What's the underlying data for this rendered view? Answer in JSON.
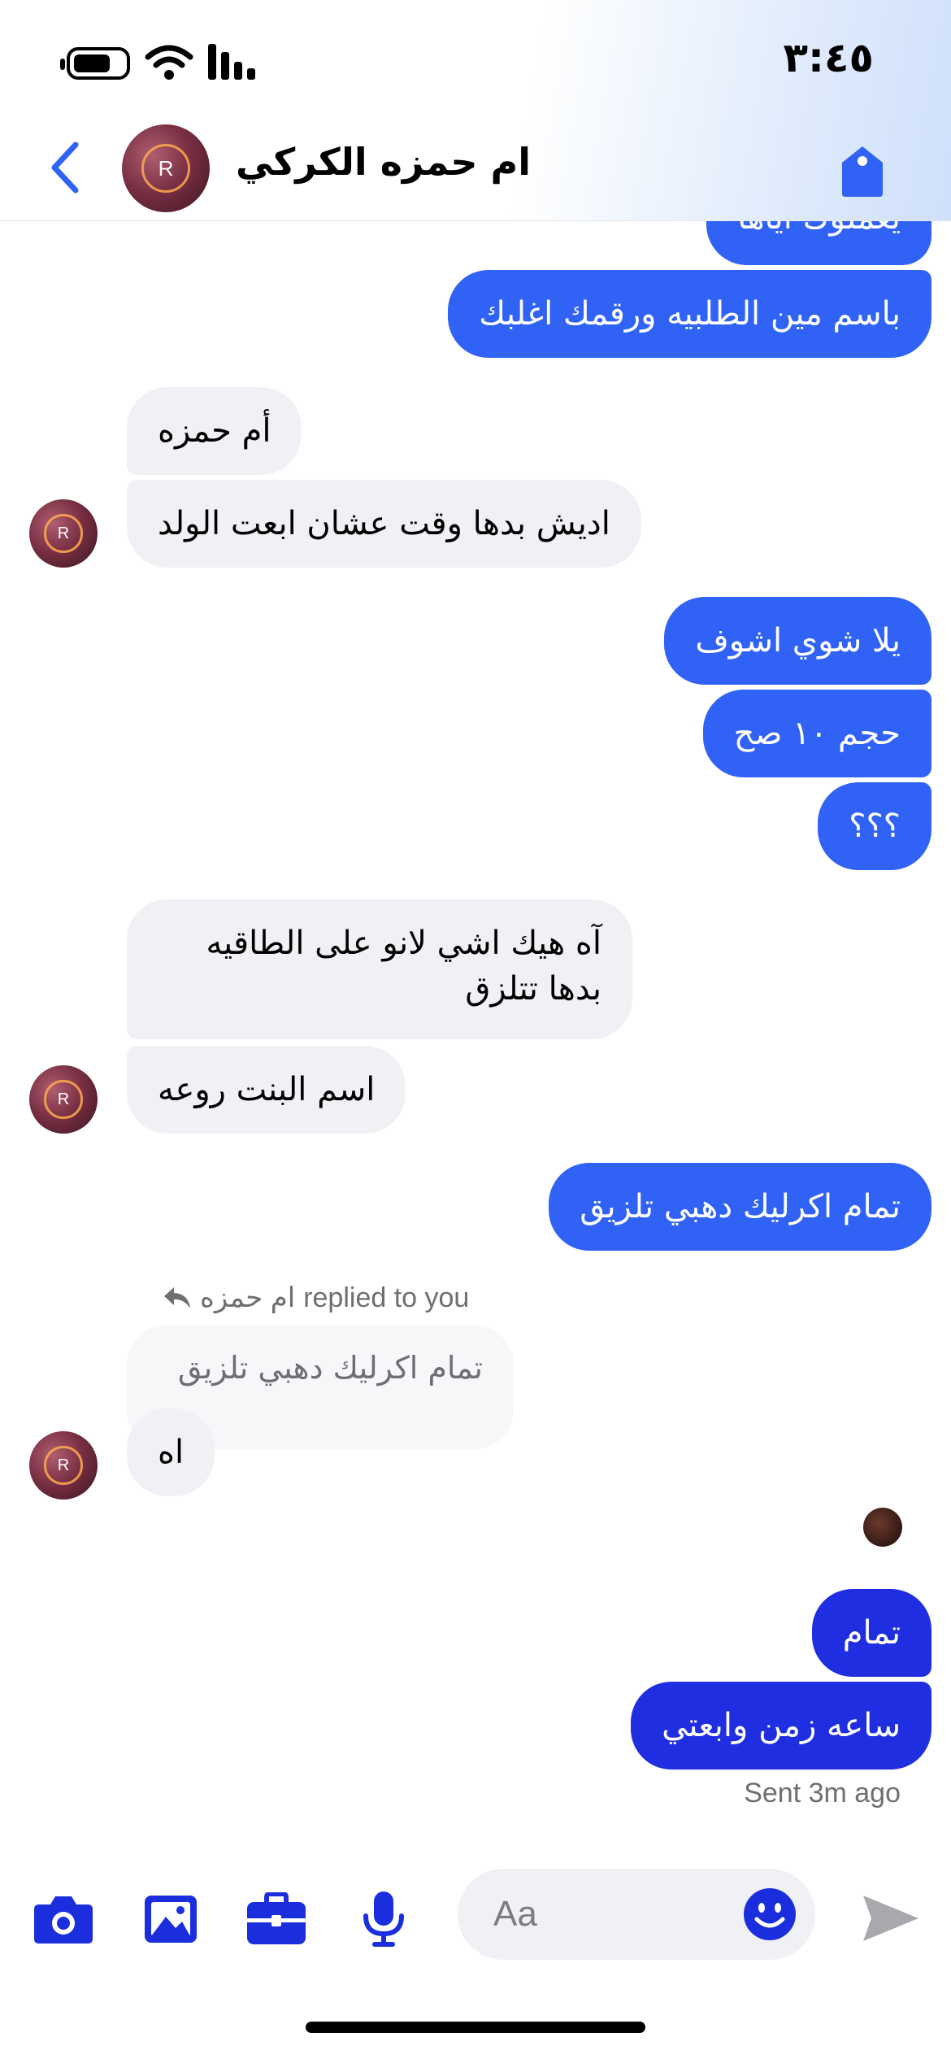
{
  "status_bar": {
    "time": "٣:٤٥"
  },
  "header": {
    "contact_name": "ام حمزه الكركي",
    "avatar_letter": "R"
  },
  "messages": {
    "m0": "يعملوك اياها",
    "m1": "باسم مين الطلبيه ورقمك اغلبك",
    "m2": "أم حمزه",
    "m3": "اديش بدها وقت عشان ابعت الولد",
    "m4": "يلا شوي اشوف",
    "m5": "حجم ١٠ صح",
    "m6": "؟؟؟",
    "m7": "آه هيك اشي لانو على الطاقيه بدها تتلزق",
    "m8": "اسم البنت روعه",
    "m9": "تمام اكرليك دهبي تلزيق",
    "m10": "اه",
    "m11": "تمام",
    "m12": "ساعه زمن وابعتي"
  },
  "reply": {
    "sender": "ام حمزه",
    "suffix": "replied to you",
    "quoted_text": "تمام اكرليك دهبي تلزيق"
  },
  "sent_status": "Sent 3m ago",
  "composer": {
    "placeholder": "Aa"
  },
  "colors": {
    "accent": "#2f62f5",
    "accent_deep": "#1f2ee0",
    "incoming_bg": "#f0f1f4",
    "icon_blue": "#1a2ede"
  },
  "icons": [
    "battery-icon",
    "wifi-icon",
    "signal-icon",
    "back-chevron-icon",
    "tag-icon",
    "camera-icon",
    "image-icon",
    "briefcase-icon",
    "microphone-icon",
    "emoji-icon",
    "send-icon",
    "reply-arrow-icon"
  ]
}
